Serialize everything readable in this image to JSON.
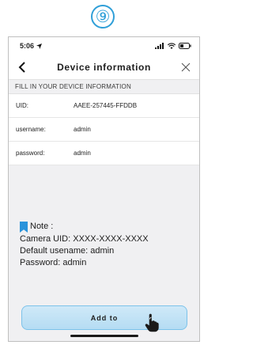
{
  "step_badge": "⑨",
  "status_bar": {
    "time": "5:06"
  },
  "nav": {
    "title": "Device information"
  },
  "form": {
    "section_header": "FILL IN YOUR DEVICE INFORMATION",
    "fields": [
      {
        "label": "UID:",
        "value": "AAEE-257445-FFDDB"
      },
      {
        "label": "username:",
        "value": "admin"
      },
      {
        "label": "password:",
        "value": "admin"
      }
    ]
  },
  "note": {
    "heading": "Note :",
    "lines": [
      "Camera UID: XXXX-XXXX-XXXX",
      "Default usename: admin",
      "Password: admin"
    ]
  },
  "add_button": {
    "label": "Add to"
  },
  "colors": {
    "accent": "#2f9fd8",
    "button_fill": "#c3e3f6",
    "button_border": "#7cc2ea",
    "bookmark": "#2a93db"
  },
  "icons": [
    "location-arrow-icon",
    "signal-icon",
    "wifi-icon",
    "battery-icon",
    "back-chevron-icon",
    "close-icon",
    "bookmark-icon",
    "pointing-hand-icon"
  ]
}
